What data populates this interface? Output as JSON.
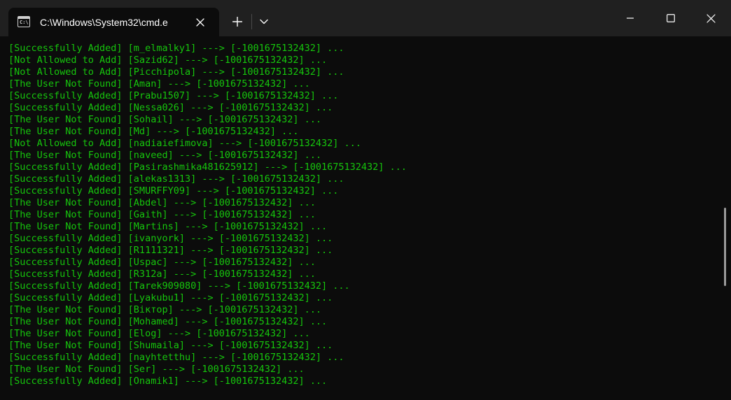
{
  "window": {
    "tab_title": "C:\\Windows\\System32\\cmd.e",
    "tab_icon": "console-icon",
    "tab_icon_glyph": "C:\\",
    "controls": [
      "minimize-icon",
      "maximize-icon",
      "close-icon"
    ]
  },
  "colors": {
    "text": "#16c60c",
    "background": "#0c0c0c",
    "titlebar": "#202020"
  },
  "console": {
    "lines": [
      "[Successfully Added] [m_elmalky1] ---> [-1001675132432] ...",
      "[Not Allowed to Add] [Sazid62] ---> [-1001675132432] ...",
      "[Not Allowed to Add] [Picchipola] ---> [-1001675132432] ...",
      "[The User Not Found] [Aman] ---> [-1001675132432] ...",
      "[Successfully Added] [Prabu1507] ---> [-1001675132432] ...",
      "[Successfully Added] [Nessa026] ---> [-1001675132432] ...",
      "[The User Not Found] [Sohail] ---> [-1001675132432] ...",
      "[The User Not Found] [Md] ---> [-1001675132432] ...",
      "[Not Allowed to Add] [nadiaiefimova] ---> [-1001675132432] ...",
      "[The User Not Found] [naveed] ---> [-1001675132432] ...",
      "[Successfully Added] [Pasirashmika481625912] ---> [-1001675132432] ...",
      "[Successfully Added] [alekas1313] ---> [-1001675132432] ...",
      "[Successfully Added] [SMURFFY09] ---> [-1001675132432] ...",
      "[The User Not Found] [Abdel] ---> [-1001675132432] ...",
      "[The User Not Found] [Gaith] ---> [-1001675132432] ...",
      "[The User Not Found] [Martins] ---> [-1001675132432] ...",
      "[Successfully Added] [ivanyork] ---> [-1001675132432] ...",
      "[Successfully Added] [R1111321] ---> [-1001675132432] ...",
      "[Successfully Added] [Uspac] ---> [-1001675132432] ...",
      "[Successfully Added] [R312a] ---> [-1001675132432] ...",
      "[Successfully Added] [Tarek909080] ---> [-1001675132432] ...",
      "[Successfully Added] [Lyakubu1] ---> [-1001675132432] ...",
      "[The User Not Found] [Віктор] ---> [-1001675132432] ...",
      "[The User Not Found] [Mohamed] ---> [-1001675132432] ...",
      "[The User Not Found] [Elog] ---> [-1001675132432] ...",
      "[The User Not Found] [Shumaila] ---> [-1001675132432] ...",
      "[Successfully Added] [nayhtetthu] ---> [-1001675132432] ...",
      "[The User Not Found] [Ser] ---> [-1001675132432] ...",
      "[Successfully Added] [Onamik1] ---> [-1001675132432] ..."
    ]
  }
}
